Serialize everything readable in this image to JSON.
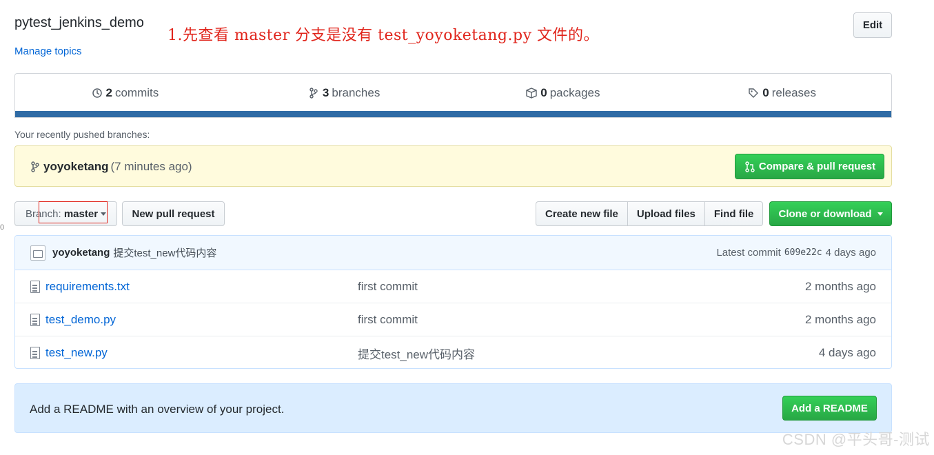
{
  "repo": {
    "name": "pytest_jenkins_demo",
    "manage_topics": "Manage topics",
    "edit_label": "Edit"
  },
  "annotation": "1.先查看 master 分支是没有 test_yoyoketang.py 文件的。",
  "summary": {
    "commits_count": "2",
    "commits_label": "commits",
    "branches_count": "3",
    "branches_label": "branches",
    "packages_count": "0",
    "packages_label": "packages",
    "releases_count": "0",
    "releases_label": "releases"
  },
  "recent": {
    "label": "Your recently pushed branches:",
    "branch": "yoyoketang",
    "time": "(7 minutes ago)",
    "compare_label": "Compare & pull request"
  },
  "toolbar": {
    "branch_prefix": "Branch:",
    "branch_name": "master",
    "new_pr": "New pull request",
    "create_file": "Create new file",
    "upload_files": "Upload files",
    "find_file": "Find file",
    "clone": "Clone or download"
  },
  "latest_commit": {
    "author": "yoyoketang",
    "message": "提交test_new代码内容",
    "latest_label": "Latest commit",
    "sha": "609e22c",
    "age": "4 days ago"
  },
  "files": [
    {
      "name": "requirements.txt",
      "message": "first commit",
      "age": "2 months ago"
    },
    {
      "name": "test_demo.py",
      "message": "first commit",
      "age": "2 months ago"
    },
    {
      "name": "test_new.py",
      "message": "提交test_new代码内容",
      "age": "4 days ago"
    }
  ],
  "readme": {
    "text": "Add a README with an overview of your project.",
    "button": "Add a README"
  },
  "watermark": "CSDN @平头哥-测试",
  "edge_mark": "0",
  "colors": {
    "link": "#0366d6",
    "green": "#28a745",
    "annotation_red": "#e0241b",
    "progress_bar": "#2f6ba5"
  }
}
